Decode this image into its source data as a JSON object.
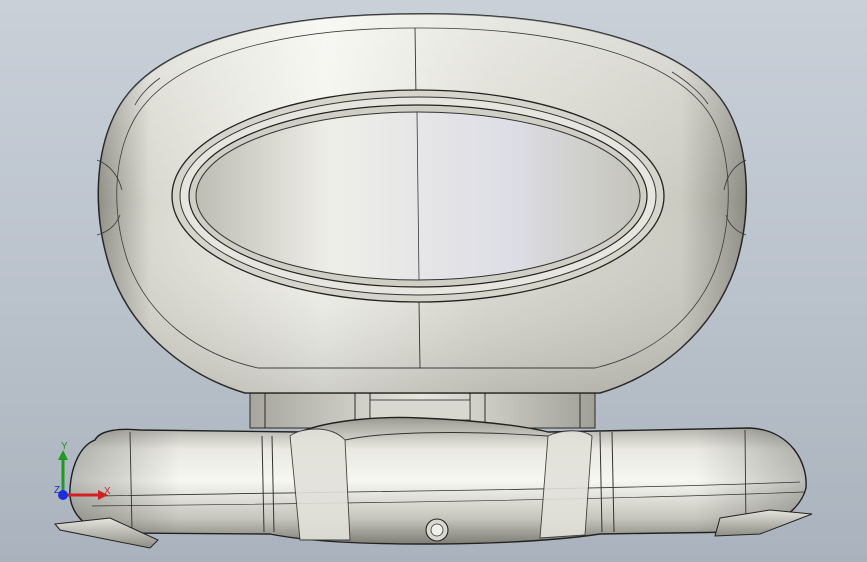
{
  "viewport": {
    "background_top": "#c9d0d8",
    "background_bottom": "#aab3bd",
    "model_color": "#cfcfc5",
    "edge_color": "#2a2a2a"
  },
  "triad": {
    "x_label": "X",
    "y_label": "Y",
    "z_label": "Z",
    "x_color": "#d42020",
    "y_color": "#1f9a1f",
    "z_color": "#1a2ee0"
  }
}
